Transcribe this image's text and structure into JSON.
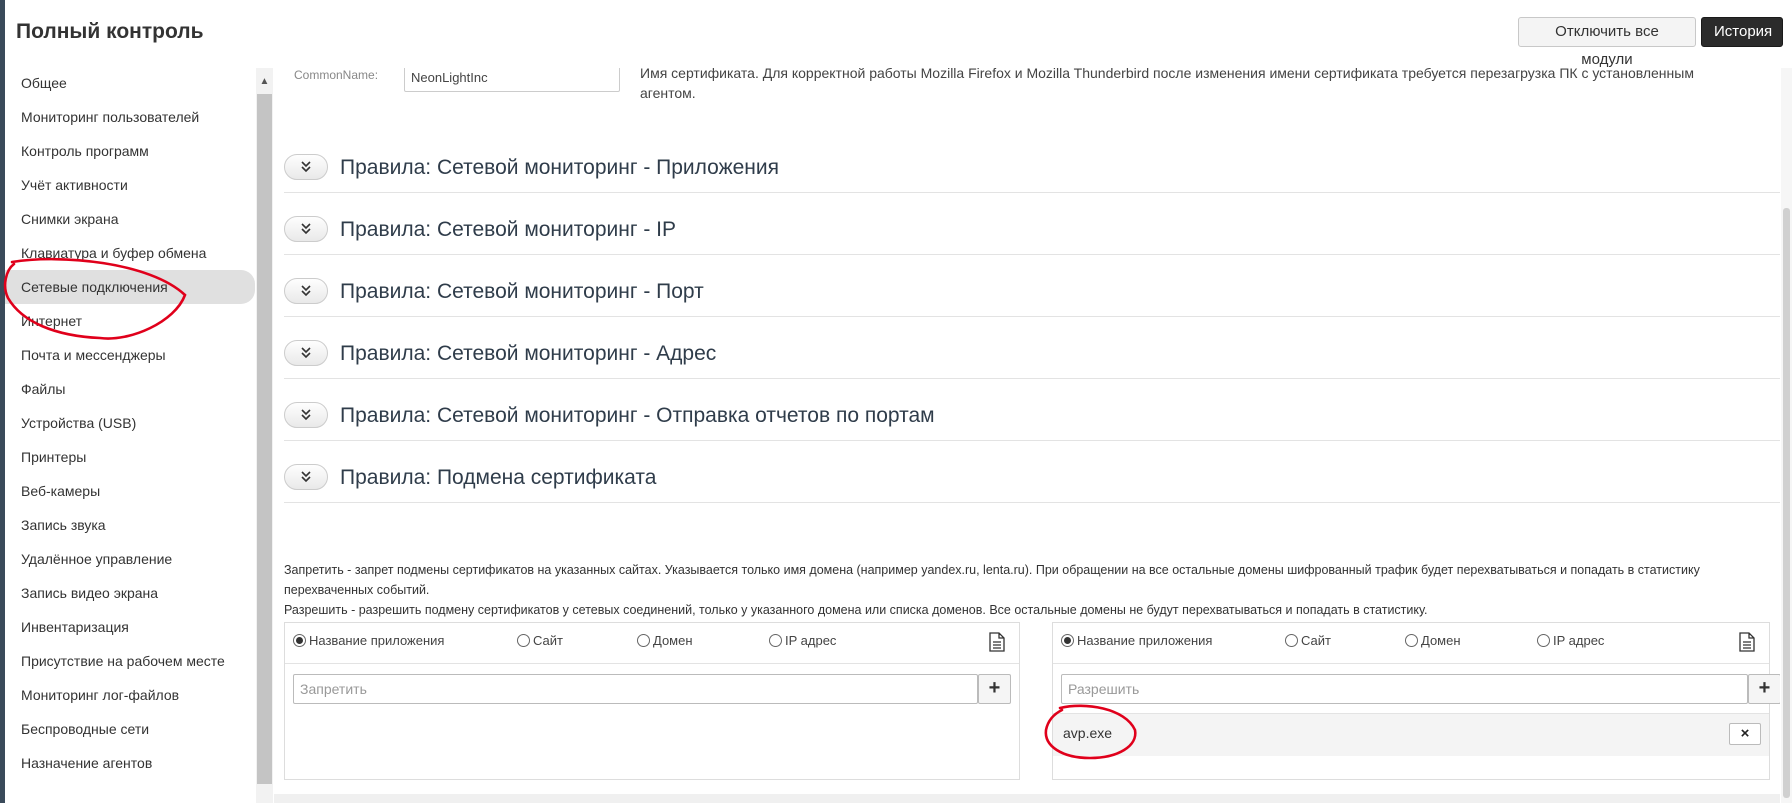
{
  "header": {
    "title": "Полный контроль",
    "disable_all_label": "Отключить все модули",
    "history_label": "История"
  },
  "sidebar": {
    "items": [
      {
        "label": "Общее"
      },
      {
        "label": "Мониторинг пользователей"
      },
      {
        "label": "Контроль программ"
      },
      {
        "label": "Учёт активности"
      },
      {
        "label": "Снимки экрана"
      },
      {
        "label": "Клавиатура и буфер обмена"
      },
      {
        "label": "Сетевые подключения",
        "active": true
      },
      {
        "label": "Интернет"
      },
      {
        "label": "Почта и мессенджеры"
      },
      {
        "label": "Файлы"
      },
      {
        "label": "Устройства (USB)"
      },
      {
        "label": "Принтеры"
      },
      {
        "label": "Веб-камеры"
      },
      {
        "label": "Запись звука"
      },
      {
        "label": "Удалённое управление"
      },
      {
        "label": "Запись видео экрана"
      },
      {
        "label": "Инвентаризация"
      },
      {
        "label": "Присутствие на рабочем месте"
      },
      {
        "label": "Мониторинг лог-файлов"
      },
      {
        "label": "Беспроводные сети"
      },
      {
        "label": "Назначение агентов"
      }
    ]
  },
  "cert": {
    "label": "CommonName:",
    "value": "NeonLightInc",
    "note": "Имя сертификата. Для корректной работы Mozilla Firefox и Mozilla Thunderbird после изменения имени сертификата требуется перезагрузка ПК с установленным агентом."
  },
  "sections": [
    {
      "title": "Правила: Сетевой мониторинг - Приложения"
    },
    {
      "title": "Правила: Сетевой мониторинг - IP"
    },
    {
      "title": "Правила: Сетевой мониторинг - Порт"
    },
    {
      "title": "Правила: Сетевой мониторинг - Адрес"
    },
    {
      "title": "Правила: Сетевой мониторинг - Отправка отчетов по портам"
    },
    {
      "title": "Правила: Подмена сертификата"
    }
  ],
  "cert_rules": {
    "desc_deny": "Запретить - запрет подмены сертификатов на указанных сайтах. Указывается только имя домена (например yandex.ru, lenta.ru). При обращении на все остальные домены шифрованный трафик будет перехватываться и попадать в статистику перехваченных событий.",
    "desc_allow": "Разрешить - разрешить подмену сертификатов у сетевых соединений, только у указанного домена или списка доменов. Все остальные домены не будут перехватываться и попадать в статистику.",
    "radio_labels": [
      "Название приложения",
      "Сайт",
      "Домен",
      "IP адрес"
    ],
    "deny_placeholder": "Запретить",
    "allow_placeholder": "Разрешить",
    "plus_label": "+",
    "remove_label": "×",
    "allow_items": [
      "avp.exe"
    ]
  },
  "colors": {
    "annotation": "#e0001b",
    "section_title": "#2f3c4a",
    "dark_button": "#2b2b2b"
  }
}
